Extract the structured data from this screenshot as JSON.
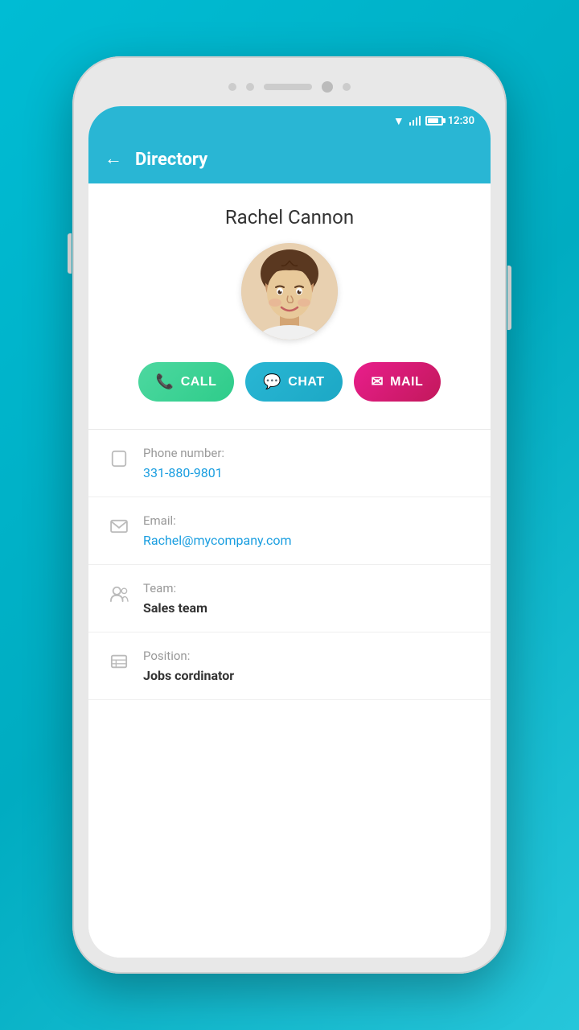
{
  "statusBar": {
    "time": "12:30"
  },
  "appBar": {
    "title": "Directory",
    "backArrow": "←"
  },
  "contact": {
    "name": "Rachel Cannon",
    "avatarAlt": "Rachel Cannon profile photo"
  },
  "buttons": {
    "call": "CALL",
    "chat": "CHAT",
    "mail": "MAIL"
  },
  "infoRows": [
    {
      "iconName": "phone-icon",
      "label": "Phone number:",
      "value": "331-880-9801",
      "valueType": "link"
    },
    {
      "iconName": "email-icon",
      "label": "Email:",
      "value": "Rachel@mycompany.com",
      "valueType": "link"
    },
    {
      "iconName": "team-icon",
      "label": "Team:",
      "value": "Sales team",
      "valueType": "dark"
    },
    {
      "iconName": "position-icon",
      "label": "Position:",
      "value": "Jobs cordinator",
      "valueType": "dark"
    }
  ]
}
